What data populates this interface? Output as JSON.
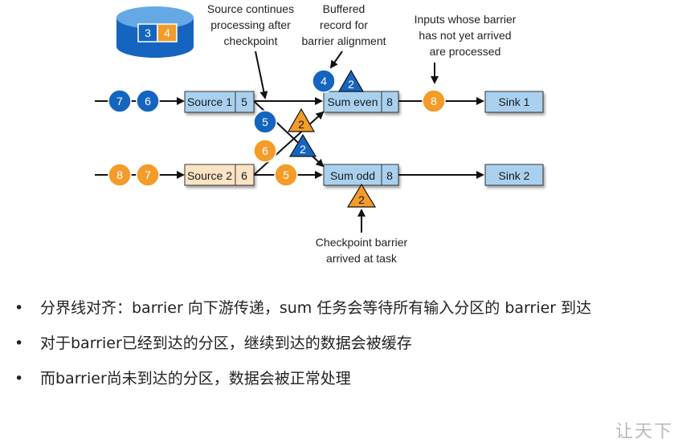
{
  "diagram": {
    "state_values": [
      "3",
      "4"
    ],
    "labels": {
      "source_continues": [
        "Source continues",
        "processing after",
        "checkpoint"
      ],
      "buffered": [
        "Buffered",
        "record for",
        "barrier alignment"
      ],
      "inputs_not_arrived": [
        "Inputs whose barrier",
        "has not yet arrived",
        "are processed"
      ],
      "checkpoint_barrier": [
        "Checkpoint barrier",
        "arrived at task"
      ]
    },
    "tasks": {
      "source1": {
        "name": "Source 1",
        "value": "5"
      },
      "source2": {
        "name": "Source 2",
        "value": "6"
      },
      "sum_even": {
        "name": "Sum even",
        "value": "8"
      },
      "sum_odd": {
        "name": "Sum odd",
        "value": "8"
      },
      "sink1": {
        "name": "Sink 1"
      },
      "sink2": {
        "name": "Sink 2"
      }
    },
    "records": {
      "src1_input": [
        "7",
        "6"
      ],
      "src2_input": [
        "8",
        "7"
      ],
      "buffered_record": "4",
      "buffered_barrier": "2",
      "cross_blue": "5",
      "cross_blue_barrier": "2",
      "cross_orange": "6",
      "cross_orange_barrier": "2",
      "to_sum_odd": "5",
      "to_sink1": "8",
      "sum_odd_barrier": "2"
    },
    "colors": {
      "blue_record": "#1565c0",
      "orange_record": "#f39c2a",
      "source2_fill": "#fde3c3",
      "task_fill": "#a9d1ef"
    }
  },
  "bullets": [
    "分界线对齐：barrier 向下游传递，sum 任务会等待所有输入分区的 barrier 到达",
    "对于barrier已经到达的分区，继续到达的数据会被缓存",
    "而barrier尚未到达的分区，数据会被正常处理"
  ],
  "watermark": "让天下"
}
